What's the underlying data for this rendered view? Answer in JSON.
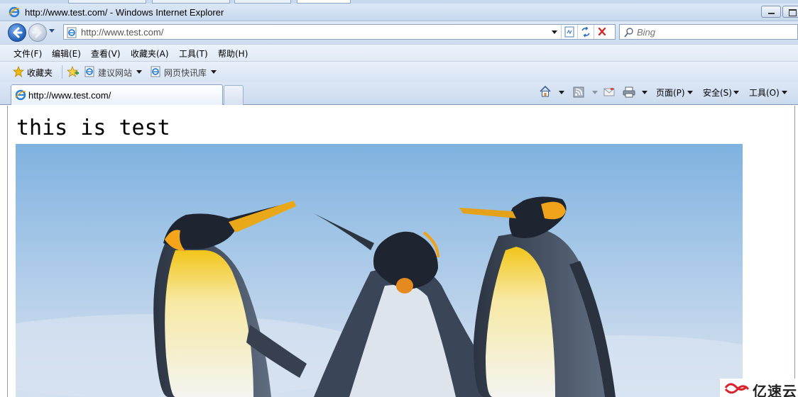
{
  "window": {
    "title": "http://www.test.com/ - Windows Internet Explorer"
  },
  "navigation": {
    "address_url": "http://www.test.com/",
    "search_placeholder": "Bing"
  },
  "menu": {
    "items": [
      "文件(F)",
      "编辑(E)",
      "查看(V)",
      "收藏夹(A)",
      "工具(T)",
      "帮助(H)"
    ]
  },
  "favorites_bar": {
    "favorites_label": "收藏夹",
    "links": [
      "建议网站",
      "网页快讯库"
    ]
  },
  "tabs": [
    {
      "label": "http://www.test.com/",
      "active": true
    }
  ],
  "command_bar": {
    "page_label": "页面(P)",
    "safety_label": "安全(S)",
    "tools_label": "工具(O)"
  },
  "page": {
    "heading": "this is test",
    "image_subject": "three king penguins on ice"
  },
  "watermark": {
    "text": "亿速云"
  },
  "colors": {
    "ie_blue": "#1f5eb5",
    "chrome_light": "#dfe9f6",
    "favorites_star": "#f2b707"
  }
}
